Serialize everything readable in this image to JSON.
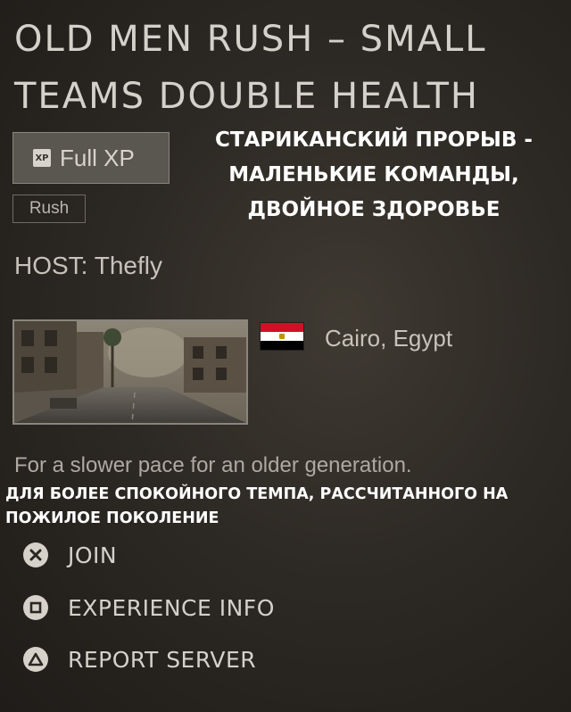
{
  "server": {
    "title_line1": "OLD MEN RUSH – SMALL",
    "title_line2": "TEAMS DOUBLE HEALTH",
    "xp_icon": "XP",
    "xp_label": "Full XP",
    "mode_label": "Rush",
    "host_label": "HOST: Thefly",
    "location_label": "Cairo, Egypt",
    "flag": "egypt-flag",
    "description": "For a slower pace for an older generation."
  },
  "translation": {
    "title": "СТАРИКАНСКИЙ ПРОРЫВ - МАЛЕНЬКИЕ КОМАНДЫ, ДВОЙНОЕ ЗДОРОВЬЕ",
    "description": "ДЛЯ БОЛЕЕ СПОКОЙНОГО ТЕМПА, РАССЧИТАННОГО НА ПОЖИЛОЕ ПОКОЛЕНИЕ"
  },
  "actions": [
    {
      "icon": "cross-button-icon",
      "label": "JOIN"
    },
    {
      "icon": "square-button-icon",
      "label": "EXPERIENCE INFO"
    },
    {
      "icon": "triangle-button-icon",
      "label": "REPORT SERVER"
    }
  ],
  "colors": {
    "background": "#2d2924",
    "text": "#d4d1ca",
    "tag_bg": "#5a5751",
    "overlay_text": "#ffffff"
  }
}
